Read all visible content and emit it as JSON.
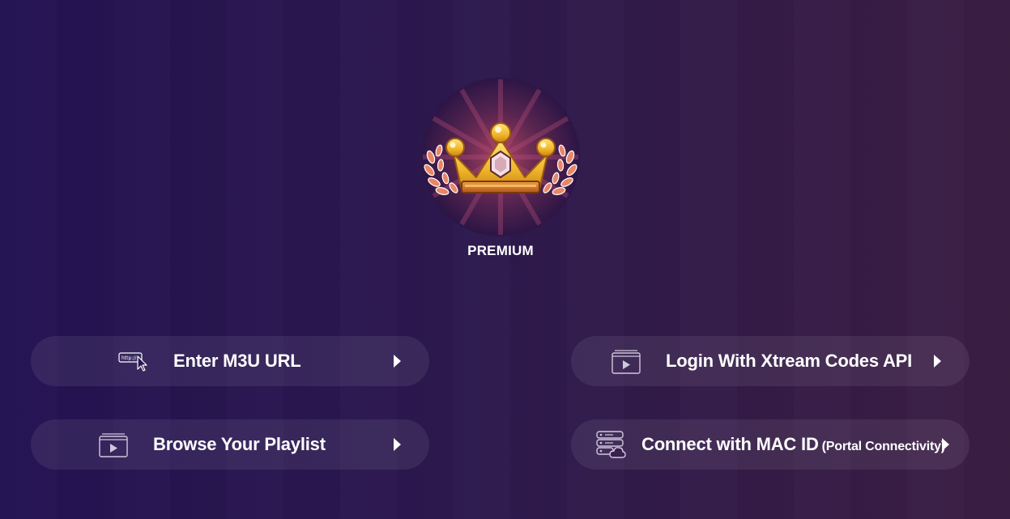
{
  "badge": {
    "label": "PREMIUM",
    "icon": "crown-icon"
  },
  "actions": [
    {
      "id": "m3u",
      "label": "Enter M3U URL",
      "icon": "url-cursor-icon",
      "icon_text": "http://"
    },
    {
      "id": "xtream",
      "label": "Login With Xtream Codes API",
      "icon": "video-player-icon"
    },
    {
      "id": "playlist",
      "label": "Browse Your Playlist",
      "icon": "video-player-icon"
    },
    {
      "id": "mac",
      "label": "Connect with MAC ID",
      "sub_label": "(Portal Connectivity)",
      "icon": "server-cloud-icon"
    }
  ],
  "colors": {
    "button_bg": "rgba(255,255,255,0.075)",
    "text": "#ffffff",
    "crown_gold": "#f2c03a",
    "laurel": "#e8866a"
  }
}
